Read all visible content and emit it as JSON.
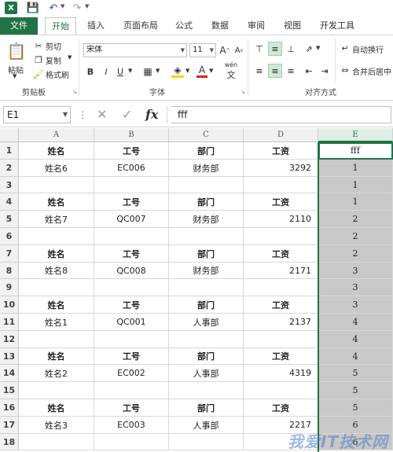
{
  "quick_access": {
    "logo": "X",
    "icons": [
      "excel-logo-icon",
      "save-icon",
      "undo-icon",
      "redo-icon"
    ]
  },
  "tabs": [
    "文件",
    "开始",
    "插入",
    "页面布局",
    "公式",
    "数据",
    "审阅",
    "视图",
    "开发工具"
  ],
  "ribbon": {
    "clipboard": {
      "paste": "粘贴",
      "cut": "剪切",
      "copy": "复制",
      "format_painter": "格式刷",
      "label": "剪贴板"
    },
    "font": {
      "name": "宋体",
      "size": "11",
      "bold": "B",
      "italic": "I",
      "underline": "U",
      "grow": "A",
      "shrink": "A",
      "label": "字体",
      "phonetic": "wén"
    },
    "alignment": {
      "wrap_text": "自动换行",
      "merge_center": "合并后居中",
      "label": "对齐方式"
    }
  },
  "formula_bar": {
    "name_box": "E1",
    "fx": "fx",
    "formula": "fff"
  },
  "columns": [
    "A",
    "B",
    "C",
    "D",
    "E"
  ],
  "rows": [
    {
      "n": "1",
      "a": "姓名",
      "b": "工号",
      "c": "部门",
      "d": "工资",
      "e": "fff",
      "hdr": true
    },
    {
      "n": "2",
      "a": "姓名6",
      "b": "EC006",
      "c": "财务部",
      "d": "3292",
      "e": "1"
    },
    {
      "n": "3",
      "a": "",
      "b": "",
      "c": "",
      "d": "",
      "e": "1"
    },
    {
      "n": "4",
      "a": "姓名",
      "b": "工号",
      "c": "部门",
      "d": "工资",
      "e": "1",
      "hdr": true
    },
    {
      "n": "5",
      "a": "姓名7",
      "b": "QC007",
      "c": "财务部",
      "d": "2110",
      "e": "2"
    },
    {
      "n": "6",
      "a": "",
      "b": "",
      "c": "",
      "d": "",
      "e": "2"
    },
    {
      "n": "7",
      "a": "姓名",
      "b": "工号",
      "c": "部门",
      "d": "工资",
      "e": "2",
      "hdr": true
    },
    {
      "n": "8",
      "a": "姓名8",
      "b": "QC008",
      "c": "财务部",
      "d": "2171",
      "e": "3"
    },
    {
      "n": "9",
      "a": "",
      "b": "",
      "c": "",
      "d": "",
      "e": "3"
    },
    {
      "n": "10",
      "a": "姓名",
      "b": "工号",
      "c": "部门",
      "d": "工资",
      "e": "3",
      "hdr": true
    },
    {
      "n": "11",
      "a": "姓名1",
      "b": "QC001",
      "c": "人事部",
      "d": "2137",
      "e": "4"
    },
    {
      "n": "12",
      "a": "",
      "b": "",
      "c": "",
      "d": "",
      "e": "4"
    },
    {
      "n": "13",
      "a": "姓名",
      "b": "工号",
      "c": "部门",
      "d": "工资",
      "e": "4",
      "hdr": true
    },
    {
      "n": "14",
      "a": "姓名2",
      "b": "EC002",
      "c": "人事部",
      "d": "4319",
      "e": "5"
    },
    {
      "n": "15",
      "a": "",
      "b": "",
      "c": "",
      "d": "",
      "e": "5"
    },
    {
      "n": "16",
      "a": "姓名",
      "b": "工号",
      "c": "部门",
      "d": "工资",
      "e": "5",
      "hdr": true
    },
    {
      "n": "17",
      "a": "姓名3",
      "b": "EC003",
      "c": "人事部",
      "d": "2217",
      "e": "6"
    },
    {
      "n": "18",
      "a": "",
      "b": "",
      "c": "",
      "d": "",
      "e": "6"
    }
  ],
  "colors": {
    "accent": "#217346",
    "selection_fill": "#c8c8c8"
  }
}
